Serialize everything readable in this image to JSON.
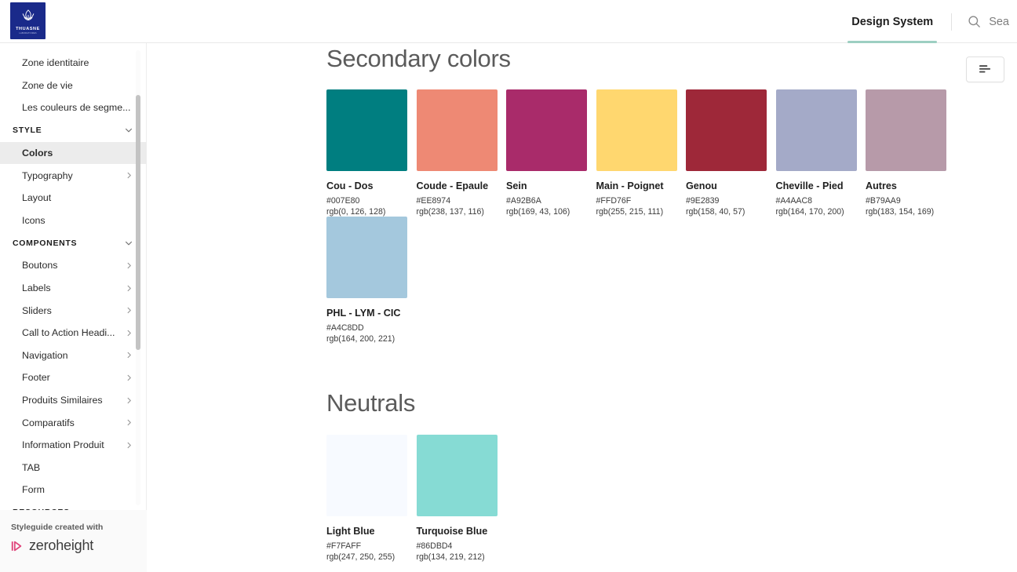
{
  "header": {
    "logo": {
      "word": "THUASNE",
      "sub": "LABORATOIRES",
      "bg": "#1a2a8a"
    },
    "nav_tab": "Design System",
    "nav_underline_color": "#9dcfc2",
    "search_icon": "search-icon",
    "search_text": "Sea"
  },
  "sidebar": {
    "items": [
      {
        "label": "Zone identitaire",
        "type": "item",
        "chevron": false,
        "active": false
      },
      {
        "label": "Zone de vie",
        "type": "item",
        "chevron": false,
        "active": false
      },
      {
        "label": "Les couleurs de segme...",
        "type": "item",
        "chevron": false,
        "active": false
      },
      {
        "label": "STYLE",
        "type": "section",
        "chevron": "down",
        "active": false
      },
      {
        "label": "Colors",
        "type": "item",
        "chevron": false,
        "active": true
      },
      {
        "label": "Typography",
        "type": "item",
        "chevron": "right",
        "active": false
      },
      {
        "label": "Layout",
        "type": "item",
        "chevron": false,
        "active": false
      },
      {
        "label": "Icons",
        "type": "item",
        "chevron": false,
        "active": false
      },
      {
        "label": "COMPONENTS",
        "type": "section",
        "chevron": "down",
        "active": false
      },
      {
        "label": "Boutons",
        "type": "item",
        "chevron": "right",
        "active": false
      },
      {
        "label": "Labels",
        "type": "item",
        "chevron": "right",
        "active": false
      },
      {
        "label": "Sliders",
        "type": "item",
        "chevron": "right",
        "active": false
      },
      {
        "label": "Call to Action Headi...",
        "type": "item",
        "chevron": "right",
        "active": false
      },
      {
        "label": "Navigation",
        "type": "item",
        "chevron": "right",
        "active": false
      },
      {
        "label": "Footer",
        "type": "item",
        "chevron": "right",
        "active": false
      },
      {
        "label": "Produits Similaires",
        "type": "item",
        "chevron": "right",
        "active": false
      },
      {
        "label": "Comparatifs",
        "type": "item",
        "chevron": "right",
        "active": false
      },
      {
        "label": "Information Produit",
        "type": "item",
        "chevron": "right",
        "active": false
      },
      {
        "label": "TAB",
        "type": "item",
        "chevron": false,
        "active": false
      },
      {
        "label": "Form",
        "type": "item",
        "chevron": false,
        "active": false
      },
      {
        "label": "RESOURCES",
        "type": "section",
        "chevron": "down",
        "active": false
      }
    ],
    "footer": {
      "title": "Styleguide created with",
      "brand": "zeroheight",
      "brand_mark_color": "#e0457b"
    }
  },
  "main": {
    "toolbar_icon": "align-left-icon",
    "sections": [
      {
        "title": "Secondary colors",
        "swatches": [
          {
            "name": "Cou - Dos",
            "hex": "#007E80",
            "rgb": "rgb(0, 126, 128)"
          },
          {
            "name": "Coude - Epaule",
            "hex": "#EE8974",
            "rgb": "rgb(238, 137, 116)"
          },
          {
            "name": "Sein",
            "hex": "#A92B6A",
            "rgb": "rgb(169, 43, 106)"
          },
          {
            "name": "Main - Poignet",
            "hex": "#FFD76F",
            "rgb": "rgb(255, 215, 111)"
          },
          {
            "name": "Genou",
            "hex": "#9E2839",
            "rgb": "rgb(158, 40, 57)"
          },
          {
            "name": "Cheville - Pied",
            "hex": "#A4AAC8",
            "rgb": "rgb(164, 170, 200)"
          },
          {
            "name": "Autres",
            "hex": "#B79AA9",
            "rgb": "rgb(183, 154, 169)"
          },
          {
            "name": "PHL - LYM - CIC",
            "hex": "#A4C8DD",
            "rgb": "rgb(164, 200, 221)"
          }
        ]
      },
      {
        "title": "Neutrals",
        "swatches": [
          {
            "name": "Light Blue",
            "hex": "#F7FAFF",
            "rgb": "rgb(247, 250, 255)"
          },
          {
            "name": "Turquoise Blue",
            "hex": "#86DBD4",
            "rgb": "rgb(134, 219, 212)"
          }
        ]
      }
    ]
  }
}
